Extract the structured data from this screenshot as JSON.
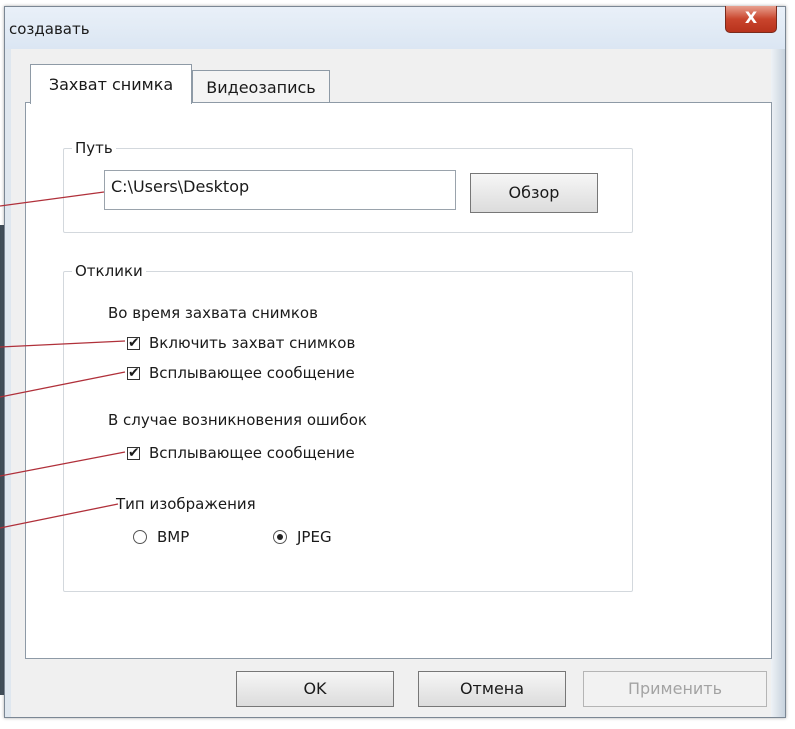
{
  "window": {
    "title": "создавать",
    "close_icon": "close-icon",
    "close_glyph": "X"
  },
  "tabs": [
    {
      "label": "Захват снимка",
      "active": true
    },
    {
      "label": "Видеозапись",
      "active": false
    }
  ],
  "path_group": {
    "legend": "Путь",
    "path_value": "C:\\Users\\Desktop",
    "browse_label": "Обзор"
  },
  "responses_group": {
    "legend": "Отклики",
    "capture_heading": "Во время захвата снимков",
    "enable_capture_label": "Включить захват снимков",
    "enable_capture_checked": true,
    "popup_capture_label": "Всплывающее сообщение",
    "popup_capture_checked": true,
    "error_heading": "В случае возникновения ошибок",
    "popup_error_label": "Всплывающее сообщение",
    "popup_error_checked": true,
    "image_type_heading": "Тип изображения",
    "bmp_label": "BMP",
    "jpeg_label": "JPEG",
    "selected_format": "JPEG"
  },
  "buttons": {
    "ok_label": "OK",
    "cancel_label": "Отмена",
    "apply_label": "Применить"
  },
  "colors": {
    "annotation_line": "#b0303a",
    "close_button": "#c9452d"
  }
}
